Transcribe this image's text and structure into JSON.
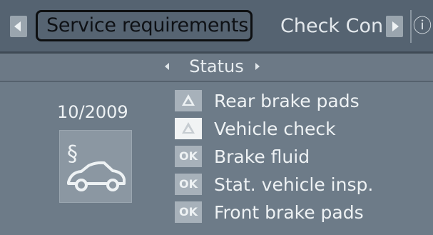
{
  "tabs": {
    "active_label": "Service requirements",
    "next_label": "Check Con",
    "left_arrow_icon": "chevron-left-icon",
    "right_arrow_icon": "chevron-right-icon",
    "info_icon": "info-icon"
  },
  "status": {
    "label": "Status"
  },
  "summary": {
    "date": "10/2009",
    "icon": "service-car-icon"
  },
  "items": [
    {
      "badge": "",
      "badge_icon": "warning-triangle-icon",
      "label": "Rear brake pads"
    },
    {
      "badge": "",
      "badge_icon": "warning-triangle-icon",
      "label": "Vehicle check"
    },
    {
      "badge": "OK",
      "label": "Brake fluid"
    },
    {
      "badge": "OK",
      "label": "Stat. vehicle insp."
    },
    {
      "badge": "OK",
      "label": "Front brake pads"
    }
  ],
  "colors": {
    "background": "#6d7b88",
    "tabbar": "#556371",
    "badge": "#a7b1ba"
  }
}
